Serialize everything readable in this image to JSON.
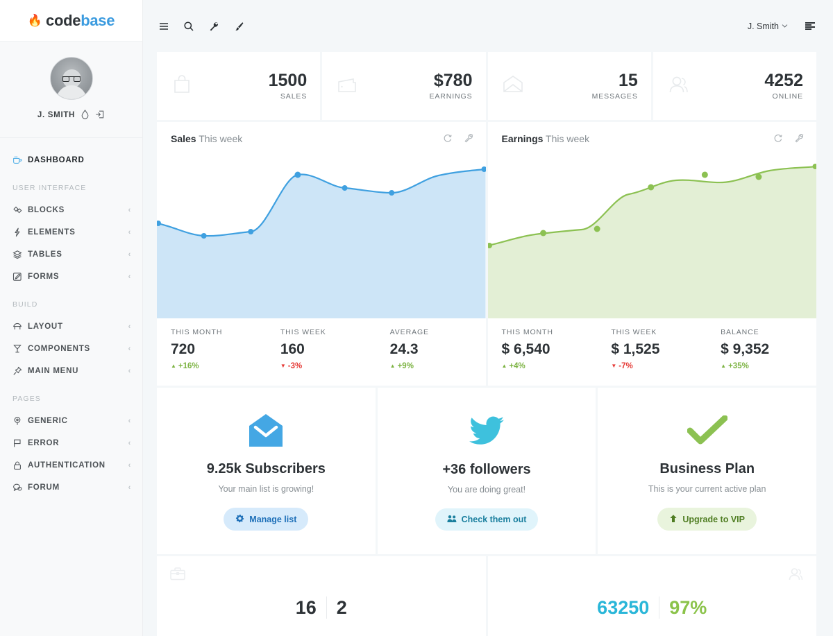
{
  "brand": {
    "flame_icon": "flame-icon",
    "code": "code",
    "base": "base"
  },
  "sidebar": {
    "user": {
      "name": "J. SMITH",
      "drop_icon": "droplet-icon",
      "logout_icon": "logout-icon"
    },
    "dashboard": {
      "label": "DASHBOARD",
      "icon": "cup-icon"
    },
    "groups": [
      {
        "heading": "USER INTERFACE",
        "items": [
          {
            "label": "BLOCKS",
            "icon": "blocks-icon",
            "caret": "‹"
          },
          {
            "label": "ELEMENTS",
            "icon": "bolt-icon",
            "caret": "‹"
          },
          {
            "label": "TABLES",
            "icon": "layers-icon",
            "caret": "‹"
          },
          {
            "label": "FORMS",
            "icon": "edit-icon",
            "caret": "‹"
          }
        ]
      },
      {
        "heading": "BUILD",
        "items": [
          {
            "label": "LAYOUT",
            "icon": "layout-icon",
            "caret": "‹"
          },
          {
            "label": "COMPONENTS",
            "icon": "components-icon",
            "caret": "‹"
          },
          {
            "label": "MAIN MENU",
            "icon": "pin-icon",
            "caret": "‹"
          }
        ]
      },
      {
        "heading": "PAGES",
        "items": [
          {
            "label": "GENERIC",
            "icon": "pin-location-icon",
            "caret": "‹"
          },
          {
            "label": "ERROR",
            "icon": "flag-icon",
            "caret": "‹"
          },
          {
            "label": "AUTHENTICATION",
            "icon": "lock-icon",
            "caret": "‹"
          },
          {
            "label": "FORUM",
            "icon": "chat-icon",
            "caret": "‹"
          }
        ]
      }
    ]
  },
  "topbar": {
    "icons": [
      "menu-icon",
      "search-icon",
      "wrench-icon",
      "brush-icon"
    ],
    "user_label": "J. Smith",
    "caret": "⌄",
    "panel_icon": "panel-icon"
  },
  "stats": [
    {
      "icon": "bag-icon",
      "value": "1500",
      "label": "SALES"
    },
    {
      "icon": "wallet-icon",
      "value": "$780",
      "label": "EARNINGS"
    },
    {
      "icon": "envelope-icon",
      "value": "15",
      "label": "MESSAGES"
    },
    {
      "icon": "user-icon",
      "value": "4252",
      "label": "ONLINE"
    }
  ],
  "charts": [
    {
      "title": "Sales",
      "subtitle": "This week",
      "refresh_icon": "refresh-icon",
      "settings_icon": "wrench-icon",
      "color": "#3fa0e0",
      "fill": "#cde5f7",
      "stats": [
        {
          "label": "THIS MONTH",
          "value": "720",
          "delta": "+16%",
          "dir": "up",
          "arrow": "▲"
        },
        {
          "label": "THIS WEEK",
          "value": "160",
          "delta": "-3%",
          "dir": "down",
          "arrow": "▼"
        },
        {
          "label": "AVERAGE",
          "value": "24.3",
          "delta": "+9%",
          "dir": "up",
          "arrow": "▲"
        }
      ]
    },
    {
      "title": "Earnings",
      "subtitle": "This week",
      "refresh_icon": "refresh-icon",
      "settings_icon": "wrench-icon",
      "color": "#8cc152",
      "fill": "#e3efd5",
      "stats": [
        {
          "label": "THIS MONTH",
          "value": "$ 6,540",
          "delta": "+4%",
          "dir": "up",
          "arrow": "▲"
        },
        {
          "label": "THIS WEEK",
          "value": "$ 1,525",
          "delta": "-7%",
          "dir": "down",
          "arrow": "▼"
        },
        {
          "label": "BALANCE",
          "value": "$ 9,352",
          "delta": "+35%",
          "dir": "up",
          "arrow": "▲"
        }
      ]
    }
  ],
  "chart_data": [
    {
      "type": "area",
      "title": "Sales",
      "subtitle": "This week",
      "xlabel": "",
      "ylabel": "",
      "grid": false,
      "legend": "none",
      "series": [
        {
          "name": "Sales",
          "color": "#3fa0e0",
          "fill": "#cde5f7",
          "x": [
            0,
            1,
            2,
            3,
            4,
            5,
            6,
            7
          ],
          "values": [
            42,
            33,
            37,
            74,
            66,
            62,
            61,
            78
          ]
        }
      ],
      "ylim": [
        0,
        100
      ]
    },
    {
      "type": "area",
      "title": "Earnings",
      "subtitle": "This week",
      "xlabel": "",
      "ylabel": "",
      "grid": false,
      "legend": "none",
      "series": [
        {
          "name": "Earnings",
          "color": "#8cc152",
          "fill": "#e3efd5",
          "x": [
            0,
            1,
            2,
            3,
            4,
            5,
            6,
            7
          ],
          "values": [
            27,
            36,
            40,
            62,
            74,
            72,
            76,
            82
          ]
        }
      ],
      "ylim": [
        0,
        100
      ]
    }
  ],
  "promos": [
    {
      "icon": "envelope-open-icon",
      "title": "9.25k Subscribers",
      "subtitle": "Your main list is growing!",
      "button": "Manage list",
      "button_icon": "gear-icon",
      "style": "blue"
    },
    {
      "icon": "twitter-icon",
      "title": "+36 followers",
      "subtitle": "You are doing great!",
      "button": "Check them out",
      "button_icon": "users-icon",
      "style": "cyan"
    },
    {
      "icon": "check-icon",
      "title": "Business Plan",
      "subtitle": "This is your current active plan",
      "button": "Upgrade to VIP",
      "button_icon": "arrow-up-icon",
      "style": "green"
    }
  ],
  "bottom_cards": [
    {
      "icon": "briefcase-icon",
      "icon_side": "left",
      "numbers": [
        {
          "value": "16",
          "style": "dark"
        },
        {
          "value": "2",
          "style": "dark"
        }
      ]
    },
    {
      "icon": "user-icon",
      "icon_side": "right",
      "numbers": [
        {
          "value": "63250",
          "style": "teal"
        },
        {
          "value": "97%",
          "style": "green"
        }
      ]
    }
  ]
}
